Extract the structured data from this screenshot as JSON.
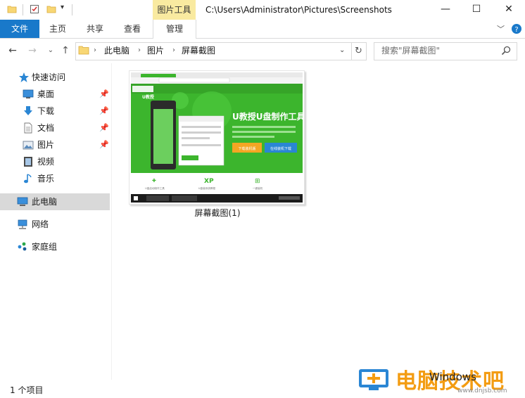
{
  "window": {
    "title": "C:\\Users\\Administrator\\Pictures\\Screenshots",
    "context_tab_group": "图片工具",
    "controls": {
      "minimize": "—",
      "maximize": "☐",
      "close": "✕"
    }
  },
  "ribbon": {
    "tabs": [
      {
        "label": "文件",
        "active": true
      },
      {
        "label": "主页"
      },
      {
        "label": "共享"
      },
      {
        "label": "查看"
      },
      {
        "label": "管理"
      }
    ]
  },
  "address": {
    "crumbs": [
      "此电脑",
      "图片",
      "屏幕截图"
    ],
    "search_placeholder": "搜索\"屏幕截图\""
  },
  "nav": {
    "quick_access": "快速访问",
    "items": [
      {
        "label": "桌面",
        "icon": "desktop-icon",
        "pinned": true
      },
      {
        "label": "下载",
        "icon": "download-icon",
        "pinned": true
      },
      {
        "label": "文档",
        "icon": "document-icon",
        "pinned": true
      },
      {
        "label": "图片",
        "icon": "pictures-icon",
        "pinned": true
      },
      {
        "label": "视频",
        "icon": "video-icon",
        "pinned": false
      },
      {
        "label": "音乐",
        "icon": "music-icon",
        "pinned": false
      }
    ],
    "this_pc": "此电脑",
    "network": "网络",
    "homegroup": "家庭组"
  },
  "files": [
    {
      "name": "屏幕截图(1)",
      "thumbnail": {
        "site_name": "U教授",
        "site_title": "U教授U盘制作工具",
        "button_download": "下载装机版",
        "button_online": "在线装机下载",
        "feature_xp": "XP",
        "feature_labels": [
          "U盘启动制作工具",
          "U盘装系统教程",
          "一键装机"
        ]
      }
    }
  ],
  "status": {
    "item_count": "1 个项目"
  },
  "watermark": {
    "text": "电脑技术吧",
    "sub": "Windows",
    "url": "www.dnjsb.com"
  },
  "colors": {
    "accent": "#1979ca",
    "context_tab": "#f9eaa0",
    "selection": "#d9d9d9",
    "thumb_green": "#3cb52d"
  }
}
